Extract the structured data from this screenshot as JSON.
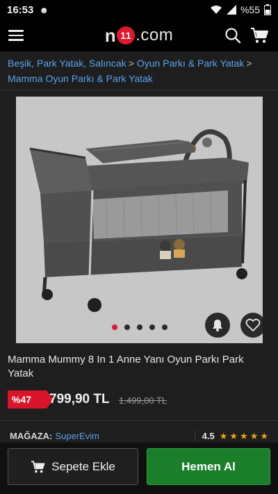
{
  "status_bar": {
    "time": "16:53",
    "battery": "%55"
  },
  "header": {
    "logo_prefix": "n",
    "logo_badge": "11",
    "logo_suffix": ".com"
  },
  "breadcrumb": [
    "Beşik, Park Yatak, Salıncak",
    "Oyun Parkı & Park Yatak",
    "Mamma Oyun Parkı & Park Yatak"
  ],
  "product": {
    "title": "Mamma Mummy 8 In 1 Anne Yanı Oyun Parkı Park Yatak",
    "discount": "%47",
    "price": "799,90 TL",
    "old_price": "1.499,00 TL",
    "image_dots": {
      "count": 5,
      "active": 0
    }
  },
  "seller": {
    "label": "MAĞAZA:",
    "name": "SuperEvim",
    "rating": "4.5",
    "stars": 5
  },
  "actions": {
    "add_to_cart": "Sepete Ekle",
    "buy_now": "Hemen Al"
  },
  "colors": {
    "brand_red": "#e0182d",
    "buy_green": "#1a7e2b",
    "link_blue": "#5aa2ee",
    "star": "#e7a51a"
  }
}
